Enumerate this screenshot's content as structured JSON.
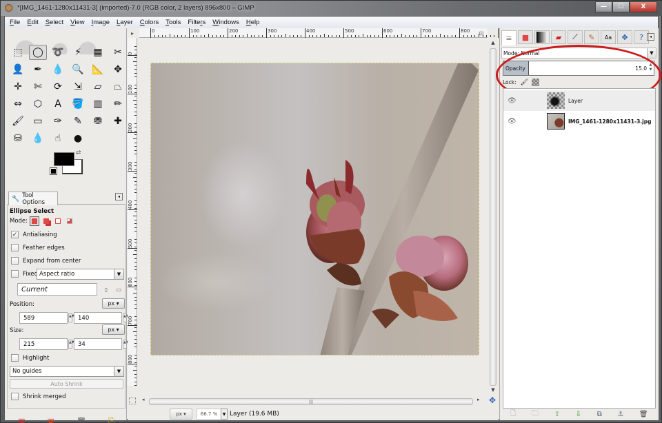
{
  "window": {
    "title": "*[IMG_1461-1280x11431-3] (imported)-7.0 (RGB color, 2 layers) 896x800 – GIMP",
    "controls": {
      "minimize": "—",
      "maximize": "☐",
      "close": "X"
    }
  },
  "menubar": {
    "items": [
      {
        "label": "File",
        "mnemonic": "F"
      },
      {
        "label": "Edit",
        "mnemonic": "E"
      },
      {
        "label": "Select",
        "mnemonic": "S"
      },
      {
        "label": "View",
        "mnemonic": "V"
      },
      {
        "label": "Image",
        "mnemonic": "I"
      },
      {
        "label": "Layer",
        "mnemonic": "L"
      },
      {
        "label": "Colors",
        "mnemonic": "C"
      },
      {
        "label": "Tools",
        "mnemonic": "T"
      },
      {
        "label": "Filters",
        "mnemonic": "r"
      },
      {
        "label": "Windows",
        "mnemonic": "W"
      },
      {
        "label": "Help",
        "mnemonic": "H"
      }
    ]
  },
  "toolbox": {
    "tools": [
      {
        "name": "rect-select",
        "glyph": "⬚"
      },
      {
        "name": "ellipse-select",
        "glyph": "◯",
        "active": true
      },
      {
        "name": "free-select",
        "glyph": "➰"
      },
      {
        "name": "fuzzy-select",
        "glyph": "⚡"
      },
      {
        "name": "select-by-color",
        "glyph": "▦"
      },
      {
        "name": "scissors-select",
        "glyph": "✂"
      },
      {
        "name": "foreground-select",
        "glyph": "👤"
      },
      {
        "name": "paths",
        "glyph": "✒"
      },
      {
        "name": "color-picker",
        "glyph": "💧"
      },
      {
        "name": "zoom",
        "glyph": "🔍"
      },
      {
        "name": "measure",
        "glyph": "📐"
      },
      {
        "name": "move",
        "glyph": "✥"
      },
      {
        "name": "align",
        "glyph": "✛"
      },
      {
        "name": "crop",
        "glyph": "✄"
      },
      {
        "name": "rotate",
        "glyph": "⟳"
      },
      {
        "name": "scale",
        "glyph": "⇲"
      },
      {
        "name": "shear",
        "glyph": "▱"
      },
      {
        "name": "perspective",
        "glyph": "⏢"
      },
      {
        "name": "flip",
        "glyph": "⇔"
      },
      {
        "name": "cage-transform",
        "glyph": "⬡"
      },
      {
        "name": "text",
        "glyph": "A"
      },
      {
        "name": "bucket-fill",
        "glyph": "🪣"
      },
      {
        "name": "blend",
        "glyph": "▥"
      },
      {
        "name": "pencil",
        "glyph": "✏"
      },
      {
        "name": "paintbrush",
        "glyph": "🖌"
      },
      {
        "name": "eraser",
        "glyph": "▭"
      },
      {
        "name": "airbrush",
        "glyph": "✑"
      },
      {
        "name": "ink",
        "glyph": "✎"
      },
      {
        "name": "clone",
        "glyph": "⛃"
      },
      {
        "name": "heal",
        "glyph": "✚"
      },
      {
        "name": "perspective-clone",
        "glyph": "⛁"
      },
      {
        "name": "blur-sharpen",
        "glyph": "💧"
      },
      {
        "name": "smudge",
        "glyph": "☝"
      },
      {
        "name": "dodge-burn",
        "glyph": "●"
      }
    ],
    "colors": {
      "foreground": "#000000",
      "background": "#ffffff"
    }
  },
  "tool_options": {
    "tab_label": "Tool Options",
    "title": "Ellipse Select",
    "mode_label": "Mode:",
    "antialiasing": {
      "label": "Antialiasing",
      "checked": true
    },
    "feather_edges": {
      "label": "Feather edges",
      "checked": false
    },
    "expand_from_center": {
      "label": "Expand from center",
      "checked": false
    },
    "fixed": {
      "label": "Fixed:",
      "checked": false,
      "option": "Aspect ratio"
    },
    "current_value": "Current",
    "position": {
      "label": "Position:",
      "unit": "px ▾",
      "x": "589",
      "y": "140"
    },
    "size": {
      "label": "Size:",
      "unit": "px ▾",
      "w": "215",
      "h": "34"
    },
    "highlight": {
      "label": "Highlight",
      "checked": false
    },
    "guides": "No guides",
    "auto_shrink": "Auto Shrink",
    "shrink_merged": {
      "label": "Shrink merged",
      "checked": false
    }
  },
  "canvas": {
    "ruler_top_labels": [
      "0",
      "100",
      "200",
      "300",
      "400",
      "500",
      "600",
      "700",
      "800",
      "90"
    ],
    "ruler_left_labels": [
      "0",
      "100",
      "200",
      "300",
      "400",
      "500",
      "600",
      "700",
      "800"
    ],
    "status": {
      "unit": "px ▾",
      "zoom": "66.7 %",
      "message": "Layer (19.6 MB)"
    }
  },
  "layers_dock": {
    "mode_label": "Mode: Normal",
    "opacity_label": "Opacity",
    "opacity_value": "15.0",
    "opacity_percent": 15,
    "lock_label": "Lock:",
    "layers": [
      {
        "name": "Layer",
        "visible": true,
        "selected": true
      },
      {
        "name": "IMG_1461-1280x11431-3.jpg",
        "visible": true,
        "selected": false
      }
    ],
    "annotation_color": "#cc1d1d"
  }
}
